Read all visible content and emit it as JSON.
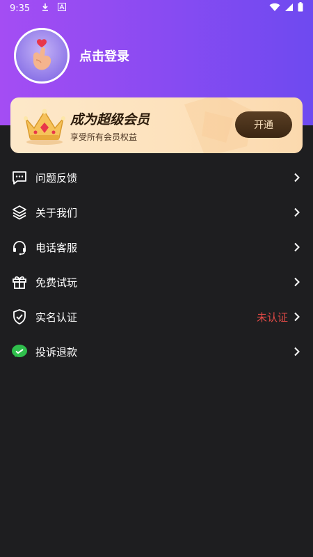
{
  "status_bar": {
    "time": "9:35",
    "icons": [
      "download-icon",
      "font-icon",
      "wifi-icon",
      "signal-icon",
      "battery-icon"
    ]
  },
  "profile": {
    "login_label": "点击登录"
  },
  "vip": {
    "title": "成为超级会员",
    "subtitle": "享受所有会员权益",
    "button_label": "开通"
  },
  "menu": {
    "items": [
      {
        "label": "问题反馈",
        "icon": "feedback-icon"
      },
      {
        "label": "关于我们",
        "icon": "layers-icon"
      },
      {
        "label": "电话客服",
        "icon": "headset-icon"
      },
      {
        "label": "免费试玩",
        "icon": "gift-icon"
      },
      {
        "label": "实名认证",
        "icon": "shield-check-icon",
        "status": "未认证"
      },
      {
        "label": "投诉退款",
        "icon": "wechat-icon"
      }
    ]
  },
  "colors": {
    "header_gradient_start": "#a44df3",
    "header_gradient_end": "#6e4af0",
    "background": "#1e1e20",
    "status_red": "#e24a46",
    "vip_card": "#fde2bd",
    "vip_button": "#3b2612"
  }
}
